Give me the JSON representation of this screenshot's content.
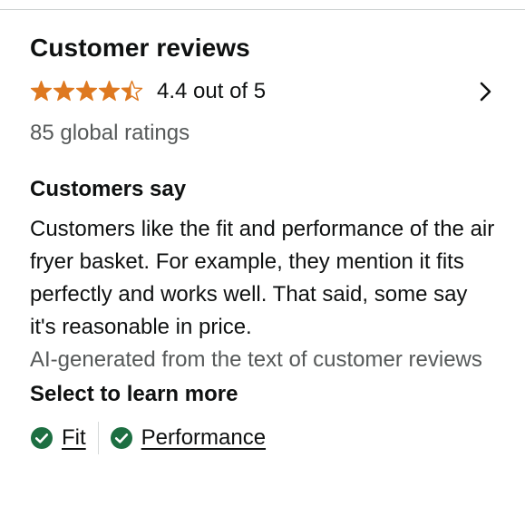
{
  "header": {
    "title": "Customer reviews"
  },
  "rating": {
    "stars": 4.4,
    "text": "4.4 out of 5",
    "star_color": "#de7921",
    "chevron_icon": "chevron-right-icon"
  },
  "global_ratings": "85 global ratings",
  "customers_say": {
    "title": "Customers say",
    "summary": "Customers like the fit and performance of the air fryer basket. For example, they mention it fits perfectly and works well. That said, some say it's reasonable in price.",
    "ai_note": "AI-generated from the text of customer reviews"
  },
  "learn_more": {
    "title": "Select to learn more",
    "chips": [
      {
        "label": "Fit",
        "icon": "check-circle-icon"
      },
      {
        "label": "Performance",
        "icon": "check-circle-icon"
      }
    ],
    "check_color": "#1d6f42"
  }
}
